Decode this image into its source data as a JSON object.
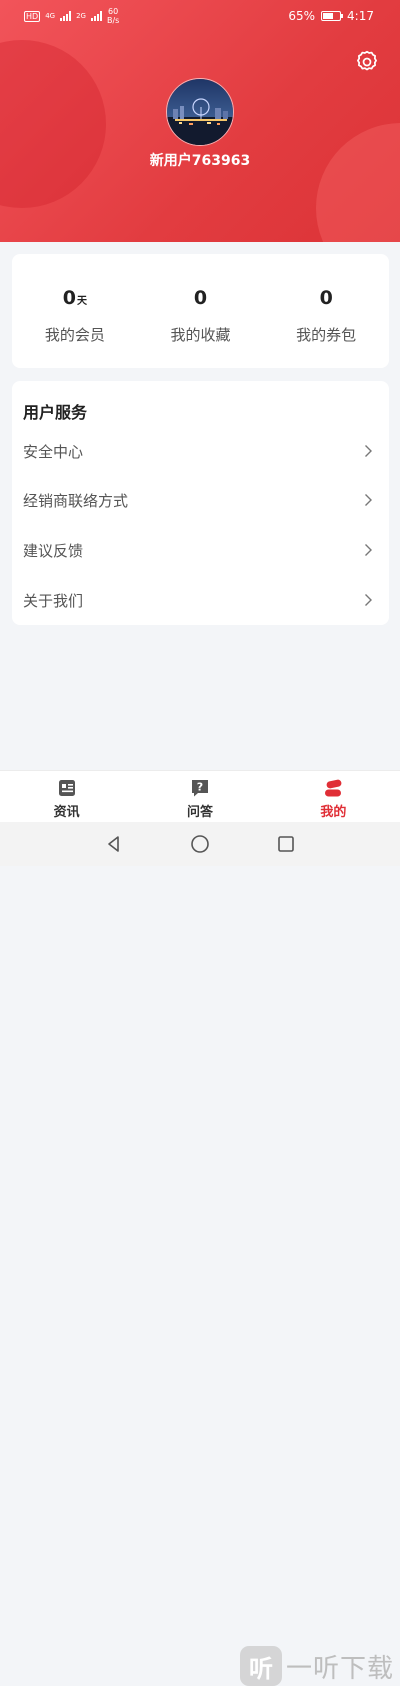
{
  "status_bar": {
    "hd": "HD",
    "net1": "4G",
    "net2": "2G",
    "speed_value": "60",
    "speed_unit": "B/s",
    "battery": "65%",
    "battery_level": 0.65,
    "time": "4:17"
  },
  "header": {
    "username": "新用户763963",
    "settings_icon": "gear-icon",
    "avatar": "city-night-photo"
  },
  "stats": [
    {
      "value": "0",
      "unit": "天",
      "label": "我的会员"
    },
    {
      "value": "0",
      "unit": "",
      "label": "我的收藏"
    },
    {
      "value": "0",
      "unit": "",
      "label": "我的券包"
    }
  ],
  "services": {
    "title": "用户服务",
    "items": [
      {
        "label": "安全中心"
      },
      {
        "label": "经销商联络方式"
      },
      {
        "label": "建议反馈"
      },
      {
        "label": "关于我们"
      }
    ]
  },
  "tabs": [
    {
      "label": "资讯",
      "icon": "news-icon",
      "active": false
    },
    {
      "label": "问答",
      "icon": "qa-icon",
      "active": false
    },
    {
      "label": "我的",
      "icon": "profile-icon",
      "active": true
    }
  ],
  "colors": {
    "brand": "#e23c40",
    "active_tab": "#e02e36"
  },
  "watermark": {
    "logo": "听",
    "text": "一听下载"
  }
}
